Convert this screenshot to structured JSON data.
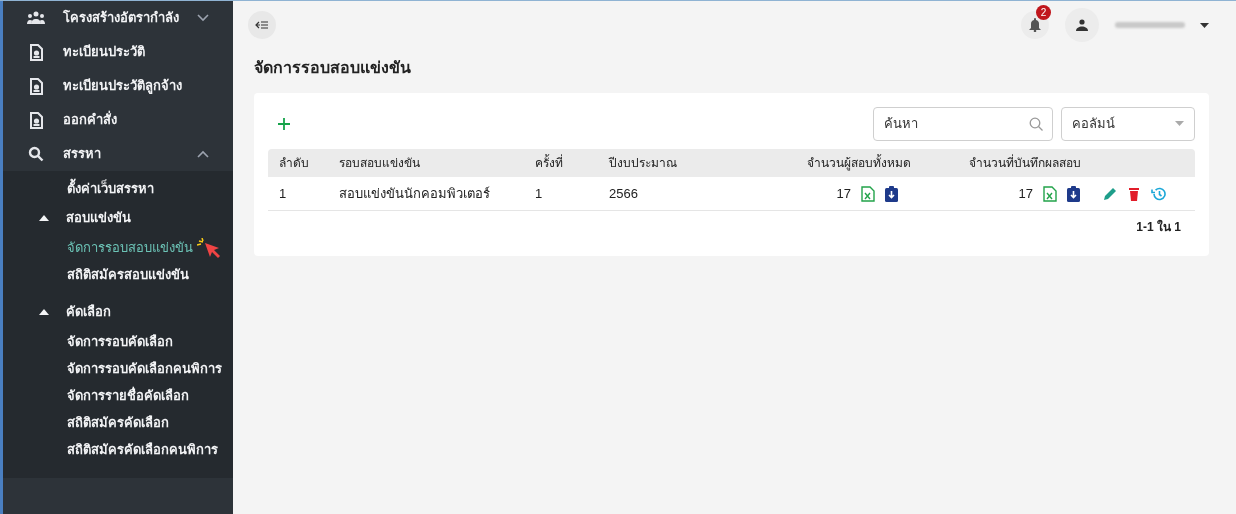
{
  "sidebar": {
    "items": [
      {
        "label": "โครงสร้างอัตรากำลัง",
        "expanded": false
      },
      {
        "label": "ทะเบียนประวัติ"
      },
      {
        "label": "ทะเบียนประวัติลูกจ้าง"
      },
      {
        "label": "ออกคำสั่ง"
      },
      {
        "label": "สรรหา",
        "expanded": true,
        "children": [
          {
            "label": "ตั้งค่าเว็บสรรหา",
            "selected": false
          },
          {
            "label": "สอบแข่งขัน",
            "expanded": true,
            "children": [
              {
                "label": "จัดการรอบสอบแข่งขัน",
                "selected": true
              },
              {
                "label": "สถิติสมัครสอบแข่งขัน",
                "selected": false
              }
            ]
          },
          {
            "label": "คัดเลือก",
            "expanded": true,
            "children": [
              {
                "label": "จัดการรอบคัดเลือก",
                "selected": false
              },
              {
                "label": "จัดการรอบคัดเลือกคนพิการ",
                "selected": false
              },
              {
                "label": "จัดการรายชื่อคัดเลือก",
                "selected": false
              },
              {
                "label": "สถิติสมัครคัดเลือก",
                "selected": false
              },
              {
                "label": "สถิติสมัครคัดเลือกคนพิการ",
                "selected": false
              }
            ]
          }
        ]
      }
    ]
  },
  "header": {
    "notification_count": "2"
  },
  "page": {
    "title": "จัดการรอบสอบแข่งขัน"
  },
  "toolbar": {
    "search": {
      "placeholder": "ค้นหา"
    },
    "column_select": {
      "placeholder": "คอลัมน์"
    }
  },
  "table": {
    "columns": [
      "ลำดับ",
      "รอบสอบแข่งขัน",
      "ครั้งที่",
      "ปีงบประมาณ",
      "จำนวนผู้สอบทั้งหมด",
      "จำนวนที่บันทึกผลสอบ"
    ],
    "rows": [
      {
        "cells": [
          "1",
          "สอบแข่งขันนักคอมพิวเตอร์",
          "1",
          "2566",
          "17",
          "17"
        ]
      }
    ],
    "pagination": "1-1 ใน 1"
  }
}
